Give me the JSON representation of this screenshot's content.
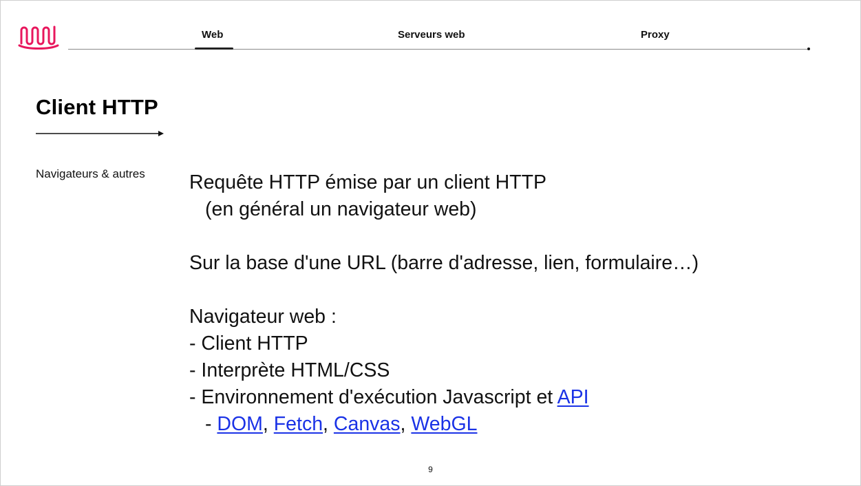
{
  "nav": {
    "tabs": [
      {
        "label": "Web",
        "active": true
      },
      {
        "label": "Serveurs web",
        "active": false
      },
      {
        "label": "Proxy",
        "active": false
      }
    ]
  },
  "brand": {
    "logo_icon": "wavy-w-logo-icon",
    "accent_color": "#e8175d"
  },
  "slide": {
    "title": "Client HTTP",
    "side_label": "Navigateurs & autres",
    "body": {
      "line1": "Requête HTTP émise par un client HTTP",
      "line2": "(en général un navigateur web)",
      "line3": "Sur la base d'une URL (barre d'adresse, lien, formulaire…)",
      "line4": "Navigateur web :",
      "bullet1": "Client HTTP",
      "bullet2": "Interprète HTML/CSS",
      "bullet3_text": "Environnement d'exécution Javascript et ",
      "bullet3_link": "API",
      "sub_links": [
        "DOM",
        "Fetch",
        "Canvas",
        "WebGL"
      ],
      "dash": "-",
      "separator": ","
    },
    "link_color": "#1a32e6",
    "page_number": "9"
  }
}
